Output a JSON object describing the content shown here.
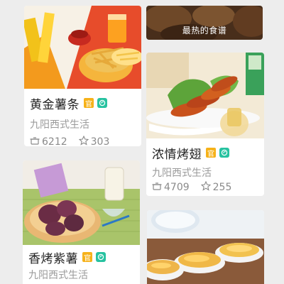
{
  "banner": {
    "label": "最热的食谱"
  },
  "recipes": [
    {
      "title": "黄金薯条",
      "badge": "官",
      "author": "九阳西式生活",
      "views": "6212",
      "favorites": "303"
    },
    {
      "title": "浓情烤翅",
      "badge": "官",
      "author": "九阳西式生活",
      "views": "4709",
      "favorites": "255"
    },
    {
      "title": "香烤紫薯",
      "badge": "官",
      "author": "九阳西式生活"
    }
  ],
  "icons": {
    "views": "cooking-pot-icon",
    "favorites": "star-outline-icon",
    "official": "official-badge-icon",
    "brand": "leaf-badge-icon"
  },
  "colors": {
    "official_badge": "#f6b21a",
    "brand_badge": "#27c2a0",
    "title_text": "#222222",
    "meta_text": "#9a9a9a"
  }
}
